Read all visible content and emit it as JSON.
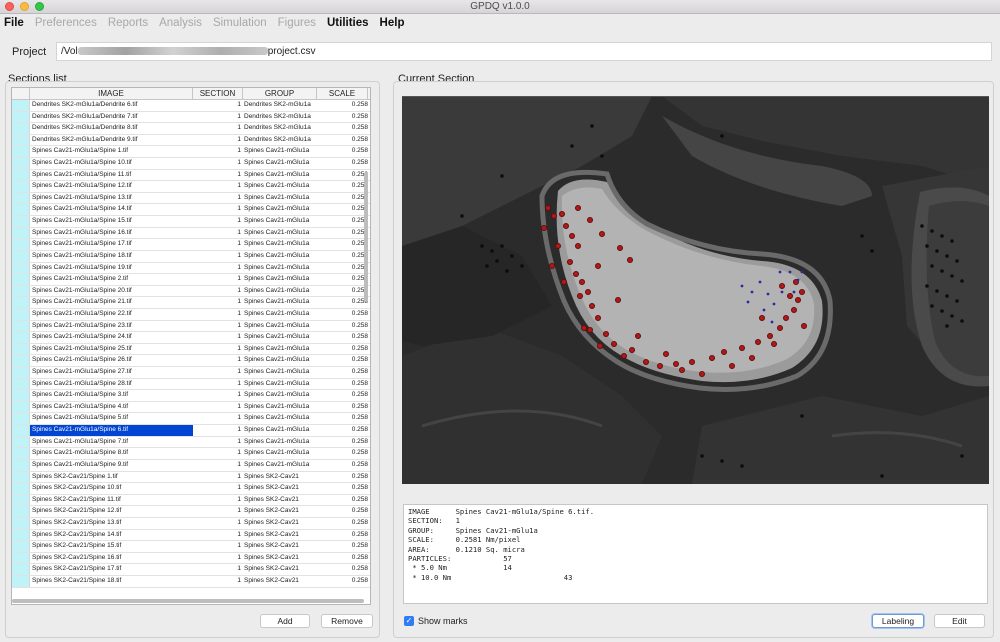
{
  "window": {
    "title": "GPDQ v1.0.0"
  },
  "menu": [
    {
      "label": "File",
      "enabled": true
    },
    {
      "label": "Preferences",
      "enabled": false
    },
    {
      "label": "Reports",
      "enabled": false
    },
    {
      "label": "Analysis",
      "enabled": false
    },
    {
      "label": "Simulation",
      "enabled": false
    },
    {
      "label": "Figures",
      "enabled": false
    },
    {
      "label": "Utilities",
      "enabled": true
    },
    {
      "label": "Help",
      "enabled": true
    }
  ],
  "project": {
    "label": "Project",
    "path_prefix": "/Vol",
    "path_suffix": "project.csv"
  },
  "sections_list": {
    "label": "Sections list",
    "columns": [
      "IMAGE",
      "SECTION",
      "GROUP",
      "SCALE"
    ],
    "rows": [
      {
        "image": "Dendrites SK2-mGlu1a/Dendrite 6.tif",
        "section": "1",
        "group": "Dendrites SK2-mGlu1a",
        "scale": "0.258"
      },
      {
        "image": "Dendrites SK2-mGlu1a/Dendrite 7.tif",
        "section": "1",
        "group": "Dendrites SK2-mGlu1a",
        "scale": "0.258"
      },
      {
        "image": "Dendrites SK2-mGlu1a/Dendrite 8.tif",
        "section": "1",
        "group": "Dendrites SK2-mGlu1a",
        "scale": "0.258"
      },
      {
        "image": "Dendrites SK2-mGlu1a/Dendrite 9.tif",
        "section": "1",
        "group": "Dendrites SK2-mGlu1a",
        "scale": "0.258"
      },
      {
        "image": "Spines Cav21-mGlu1a/Spine 1.tif",
        "section": "1",
        "group": "Spines Cav21-mGlu1a",
        "scale": "0.258"
      },
      {
        "image": "Spines Cav21-mGlu1a/Spine 10.tif",
        "section": "1",
        "group": "Spines Cav21-mGlu1a",
        "scale": "0.258"
      },
      {
        "image": "Spines Cav21-mGlu1a/Spine 11.tif",
        "section": "1",
        "group": "Spines Cav21-mGlu1a",
        "scale": "0.258"
      },
      {
        "image": "Spines Cav21-mGlu1a/Spine 12.tif",
        "section": "1",
        "group": "Spines Cav21-mGlu1a",
        "scale": "0.258"
      },
      {
        "image": "Spines Cav21-mGlu1a/Spine 13.tif",
        "section": "1",
        "group": "Spines Cav21-mGlu1a",
        "scale": "0.258"
      },
      {
        "image": "Spines Cav21-mGlu1a/Spine 14.tif",
        "section": "1",
        "group": "Spines Cav21-mGlu1a",
        "scale": "0.258"
      },
      {
        "image": "Spines Cav21-mGlu1a/Spine 15.tif",
        "section": "1",
        "group": "Spines Cav21-mGlu1a",
        "scale": "0.258"
      },
      {
        "image": "Spines Cav21-mGlu1a/Spine 16.tif",
        "section": "1",
        "group": "Spines Cav21-mGlu1a",
        "scale": "0.258"
      },
      {
        "image": "Spines Cav21-mGlu1a/Spine 17.tif",
        "section": "1",
        "group": "Spines Cav21-mGlu1a",
        "scale": "0.258"
      },
      {
        "image": "Spines Cav21-mGlu1a/Spine 18.tif",
        "section": "1",
        "group": "Spines Cav21-mGlu1a",
        "scale": "0.258"
      },
      {
        "image": "Spines Cav21-mGlu1a/Spine 19.tif",
        "section": "1",
        "group": "Spines Cav21-mGlu1a",
        "scale": "0.258"
      },
      {
        "image": "Spines Cav21-mGlu1a/Spine 2.tif",
        "section": "1",
        "group": "Spines Cav21-mGlu1a",
        "scale": "0.258"
      },
      {
        "image": "Spines Cav21-mGlu1a/Spine 20.tif",
        "section": "1",
        "group": "Spines Cav21-mGlu1a",
        "scale": "0.258"
      },
      {
        "image": "Spines Cav21-mGlu1a/Spine 21.tif",
        "section": "1",
        "group": "Spines Cav21-mGlu1a",
        "scale": "0.258"
      },
      {
        "image": "Spines Cav21-mGlu1a/Spine 22.tif",
        "section": "1",
        "group": "Spines Cav21-mGlu1a",
        "scale": "0.258"
      },
      {
        "image": "Spines Cav21-mGlu1a/Spine 23.tif",
        "section": "1",
        "group": "Spines Cav21-mGlu1a",
        "scale": "0.258"
      },
      {
        "image": "Spines Cav21-mGlu1a/Spine 24.tif",
        "section": "1",
        "group": "Spines Cav21-mGlu1a",
        "scale": "0.258"
      },
      {
        "image": "Spines Cav21-mGlu1a/Spine 25.tif",
        "section": "1",
        "group": "Spines Cav21-mGlu1a",
        "scale": "0.258"
      },
      {
        "image": "Spines Cav21-mGlu1a/Spine 26.tif",
        "section": "1",
        "group": "Spines Cav21-mGlu1a",
        "scale": "0.258"
      },
      {
        "image": "Spines Cav21-mGlu1a/Spine 27.tif",
        "section": "1",
        "group": "Spines Cav21-mGlu1a",
        "scale": "0.258"
      },
      {
        "image": "Spines Cav21-mGlu1a/Spine 28.tif",
        "section": "1",
        "group": "Spines Cav21-mGlu1a",
        "scale": "0.258"
      },
      {
        "image": "Spines Cav21-mGlu1a/Spine 3.tif",
        "section": "1",
        "group": "Spines Cav21-mGlu1a",
        "scale": "0.258"
      },
      {
        "image": "Spines Cav21-mGlu1a/Spine 4.tif",
        "section": "1",
        "group": "Spines Cav21-mGlu1a",
        "scale": "0.258"
      },
      {
        "image": "Spines Cav21-mGlu1a/Spine 5.tif",
        "section": "1",
        "group": "Spines Cav21-mGlu1a",
        "scale": "0.258"
      },
      {
        "image": "Spines Cav21-mGlu1a/Spine 6.tif",
        "section": "1",
        "group": "Spines Cav21-mGlu1a",
        "scale": "0.258",
        "selected": true
      },
      {
        "image": "Spines Cav21-mGlu1a/Spine 7.tif",
        "section": "1",
        "group": "Spines Cav21-mGlu1a",
        "scale": "0.258"
      },
      {
        "image": "Spines Cav21-mGlu1a/Spine 8.tif",
        "section": "1",
        "group": "Spines Cav21-mGlu1a",
        "scale": "0.258"
      },
      {
        "image": "Spines Cav21-mGlu1a/Spine 9.tif",
        "section": "1",
        "group": "Spines Cav21-mGlu1a",
        "scale": "0.258"
      },
      {
        "image": "Spines SK2-Cav21/Spine 1.tif",
        "section": "1",
        "group": "Spines SK2-Cav21",
        "scale": "0.258"
      },
      {
        "image": "Spines SK2-Cav21/Spine 10.tif",
        "section": "1",
        "group": "Spines SK2-Cav21",
        "scale": "0.258"
      },
      {
        "image": "Spines SK2-Cav21/Spine 11.tif",
        "section": "1",
        "group": "Spines SK2-Cav21",
        "scale": "0.258"
      },
      {
        "image": "Spines SK2-Cav21/Spine 12.tif",
        "section": "1",
        "group": "Spines SK2-Cav21",
        "scale": "0.258"
      },
      {
        "image": "Spines SK2-Cav21/Spine 13.tif",
        "section": "1",
        "group": "Spines SK2-Cav21",
        "scale": "0.258"
      },
      {
        "image": "Spines SK2-Cav21/Spine 14.tif",
        "section": "1",
        "group": "Spines SK2-Cav21",
        "scale": "0.258"
      },
      {
        "image": "Spines SK2-Cav21/Spine 15.tif",
        "section": "1",
        "group": "Spines SK2-Cav21",
        "scale": "0.258"
      },
      {
        "image": "Spines SK2-Cav21/Spine 16.tif",
        "section": "1",
        "group": "Spines SK2-Cav21",
        "scale": "0.258"
      },
      {
        "image": "Spines SK2-Cav21/Spine 17.tif",
        "section": "1",
        "group": "Spines SK2-Cav21",
        "scale": "0.258"
      },
      {
        "image": "Spines SK2-Cav21/Spine 18.tif",
        "section": "1",
        "group": "Spines SK2-Cav21",
        "scale": "0.258"
      }
    ],
    "buttons": {
      "add": "Add",
      "remove": "Remove"
    }
  },
  "current_section": {
    "label": "Current Section",
    "info": [
      "IMAGE      Spines Cav21-mGlu1a/Spine 6.tif.",
      "SECTION:   1",
      "GROUP:     Spines Cav21-mGlu1a",
      "SCALE:     0.2581 Nm/pixel",
      "AREA:      0.1210 Sq. micra",
      "PARTICLES:            57",
      " * 5.0 Nm             14",
      " * 10.0 Nm                          43"
    ],
    "show_marks_label": "Show marks",
    "show_marks_checked": true,
    "buttons": {
      "labeling": "Labeling",
      "edit": "Edit"
    }
  },
  "colors": {
    "selection": "#0045d4",
    "index_cell": "#bff3f7",
    "checkbox": "#2f7cf6",
    "mark_large": "#b01818",
    "mark_small": "#2a2aa8"
  }
}
